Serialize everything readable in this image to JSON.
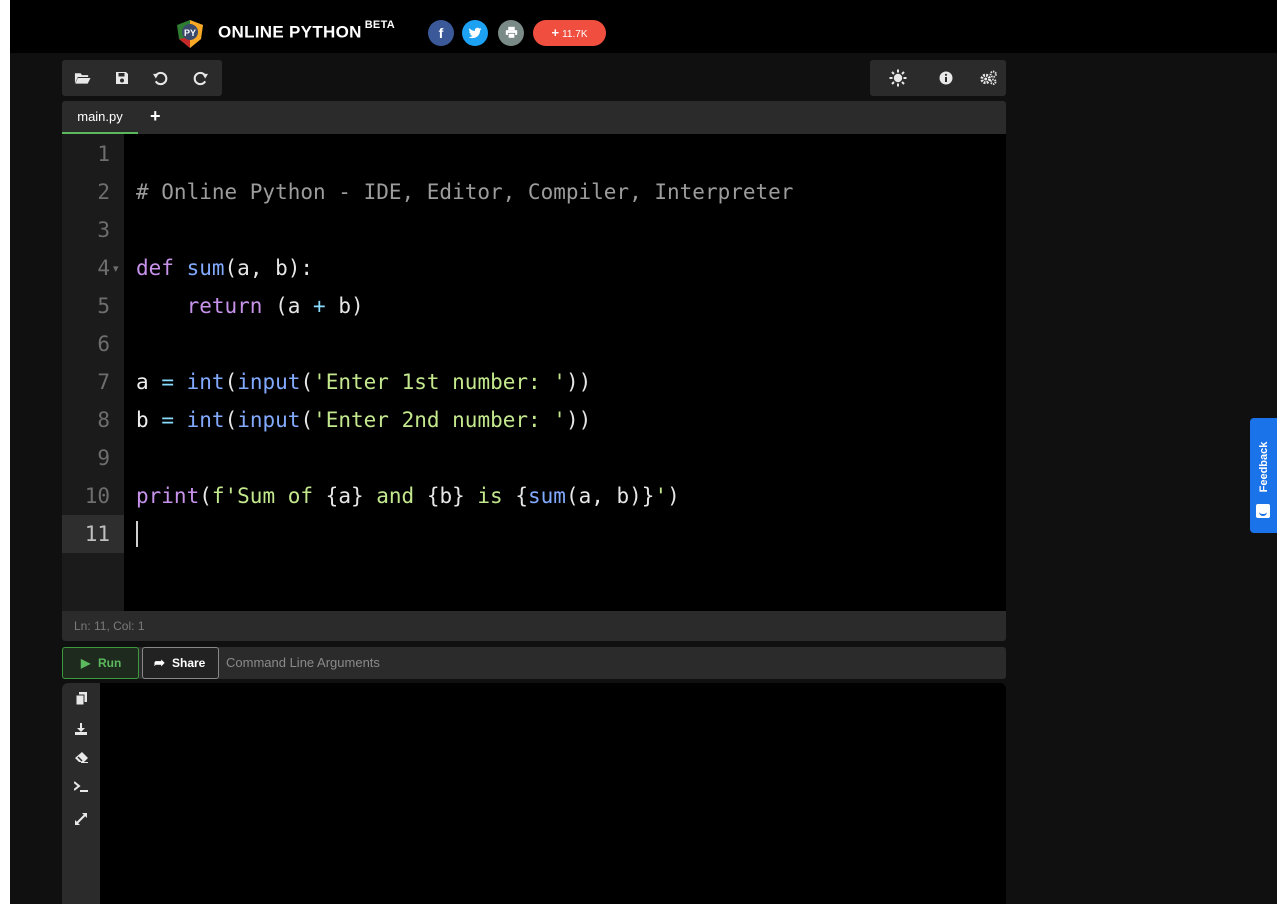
{
  "header": {
    "brand": "ONLINE PYTHON",
    "badge": "BETA",
    "logo_text": "PY",
    "share_count": "11.7K",
    "share_plus": "+"
  },
  "toolbar": {
    "left_icons": [
      "open-folder-icon",
      "save-icon",
      "undo-icon",
      "redo-icon"
    ],
    "right_icons": [
      "theme-icon",
      "info-icon",
      "settings-icon"
    ]
  },
  "tabs": [
    {
      "label": "main.py",
      "active": true
    }
  ],
  "tab_add_label": "+",
  "editor": {
    "line_numbers": [
      "1",
      "2",
      "3",
      "4",
      "5",
      "6",
      "7",
      "8",
      "9",
      "10",
      "11"
    ],
    "active_line": 11
  },
  "status": {
    "position": "Ln: 11,  Col: 1"
  },
  "actions": {
    "run_label": "Run",
    "share_label": "Share",
    "args_placeholder": "Command Line Arguments"
  },
  "terminal": {
    "side_icons": [
      "copy-icon",
      "download-icon",
      "eraser-icon",
      "terminal-icon",
      "expand-icon"
    ]
  },
  "feedback": {
    "label": "Feedback"
  },
  "colors": {
    "run_green": "#5cb85c",
    "share_red": "#f04e3e",
    "feedback_blue": "#1a73e8",
    "keyword": "#c792ea",
    "function": "#82aaff",
    "string": "#c3e88d"
  }
}
